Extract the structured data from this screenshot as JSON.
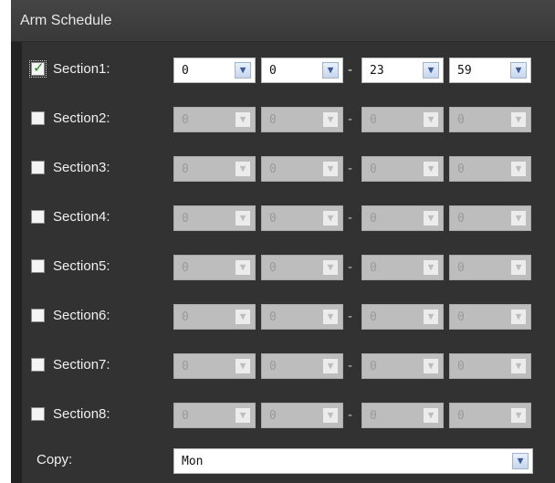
{
  "title": "Arm Schedule",
  "dash": "-",
  "sections": [
    {
      "label": "Section1:",
      "checked": true,
      "enabled": true,
      "start_hour": "0",
      "start_minute": "0",
      "end_hour": "23",
      "end_minute": "59"
    },
    {
      "label": "Section2:",
      "checked": false,
      "enabled": false,
      "start_hour": "0",
      "start_minute": "0",
      "end_hour": "0",
      "end_minute": "0"
    },
    {
      "label": "Section3:",
      "checked": false,
      "enabled": false,
      "start_hour": "0",
      "start_minute": "0",
      "end_hour": "0",
      "end_minute": "0"
    },
    {
      "label": "Section4:",
      "checked": false,
      "enabled": false,
      "start_hour": "0",
      "start_minute": "0",
      "end_hour": "0",
      "end_minute": "0"
    },
    {
      "label": "Section5:",
      "checked": false,
      "enabled": false,
      "start_hour": "0",
      "start_minute": "0",
      "end_hour": "0",
      "end_minute": "0"
    },
    {
      "label": "Section6:",
      "checked": false,
      "enabled": false,
      "start_hour": "0",
      "start_minute": "0",
      "end_hour": "0",
      "end_minute": "0"
    },
    {
      "label": "Section7:",
      "checked": false,
      "enabled": false,
      "start_hour": "0",
      "start_minute": "0",
      "end_hour": "0",
      "end_minute": "0"
    },
    {
      "label": "Section8:",
      "checked": false,
      "enabled": false,
      "start_hour": "0",
      "start_minute": "0",
      "end_hour": "0",
      "end_minute": "0"
    }
  ],
  "copy": {
    "label": "Copy:",
    "value": "Mon"
  },
  "icons": {
    "checkbox_mark": "checkmark-icon",
    "dropdown": "chevron-down-icon"
  }
}
